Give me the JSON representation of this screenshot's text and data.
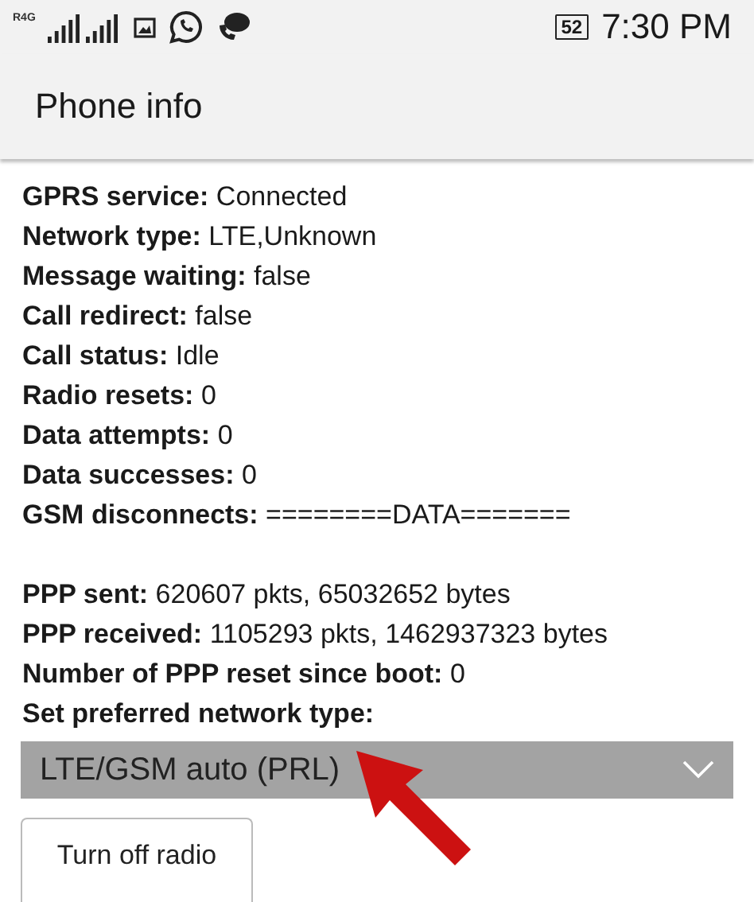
{
  "status_bar": {
    "network_label": "R4G",
    "battery": "52",
    "time": "7:30 PM"
  },
  "app_bar": {
    "title": "Phone info"
  },
  "info_rows": [
    {
      "label": "GPRS service:",
      "value": "Connected"
    },
    {
      "label": "Network type:",
      "value": "LTE,Unknown"
    },
    {
      "label": "Message waiting:",
      "value": "false"
    },
    {
      "label": "Call redirect:",
      "value": "false"
    },
    {
      "label": "Call status:",
      "value": "Idle"
    },
    {
      "label": "Radio resets:",
      "value": "0"
    },
    {
      "label": "Data attempts:",
      "value": "0"
    },
    {
      "label": "Data successes:",
      "value": "0"
    },
    {
      "label": "GSM disconnects:",
      "value": "========DATA======="
    }
  ],
  "ppp_rows": [
    {
      "label": "PPP sent:",
      "value": "620607 pkts, 65032652 bytes"
    },
    {
      "label": "PPP received:",
      "value": "1105293 pkts, 1462937323 bytes"
    },
    {
      "label": "Number of PPP reset since boot:",
      "value": "0"
    },
    {
      "label": "Set preferred network type:"
    }
  ],
  "network_type_dropdown": {
    "value": "LTE/GSM auto (PRL)"
  },
  "buttons": [
    {
      "label": "Turn off radio",
      "disabled": false
    }
  ]
}
